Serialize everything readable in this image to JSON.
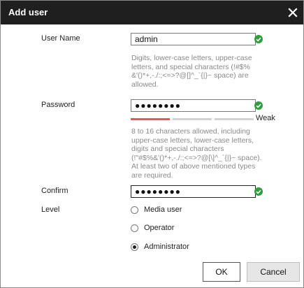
{
  "dialog": {
    "title": "Add user",
    "close_icon": "close-icon"
  },
  "username": {
    "label": "User Name",
    "value": "admin",
    "hint": "Digits, lower-case letters, upper-case letters, and special characters (!#$% &'()*+,-./:;<=>?@[]^_`{|}~ space) are allowed.",
    "valid_icon": "check-circle-icon"
  },
  "password": {
    "label": "Password",
    "value": "●●●●●●●●",
    "strength_label": "Weak",
    "strength_level": 1,
    "strength_segments": 4,
    "hint": "8 to 16 characters allowed, including upper-case letters, lower-case letters, digits and special characters (!\"#$%&'()*+,-./:;<=>?@[\\]^_`{|}~ space). At least two of above mentioned types are required.",
    "valid_icon": "check-circle-icon"
  },
  "confirm": {
    "label": "Confirm",
    "value": "●●●●●●●●",
    "valid_icon": "check-circle-icon"
  },
  "level": {
    "label": "Level",
    "options": [
      {
        "label": "Media user",
        "selected": false
      },
      {
        "label": "Operator",
        "selected": false
      },
      {
        "label": "Administrator",
        "selected": true
      }
    ]
  },
  "buttons": {
    "ok": "OK",
    "cancel": "Cancel"
  },
  "colors": {
    "titlebar": "#1f1f1f",
    "valid": "#2e9e3f",
    "strength_weak": "#e8565f",
    "strength_empty": "#d2d2d2"
  }
}
